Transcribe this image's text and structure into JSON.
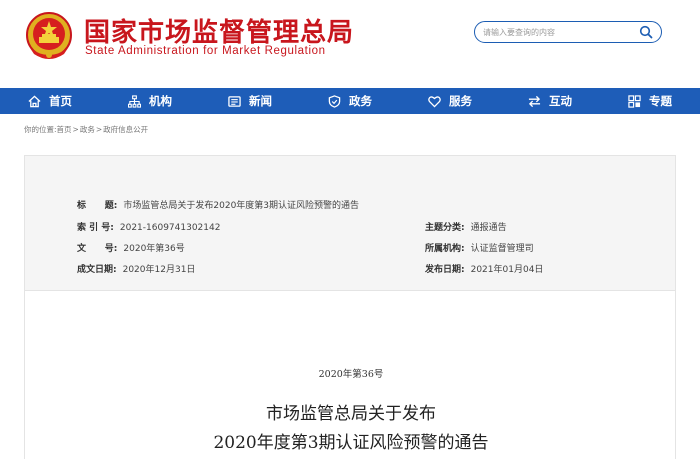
{
  "header": {
    "title_cn": "国家市场监督管理总局",
    "title_en": "State Administration for Market Regulation",
    "search_placeholder": "请输入要查询的内容"
  },
  "nav": {
    "items": [
      {
        "label": "首页",
        "icon": "home-icon"
      },
      {
        "label": "机构",
        "icon": "org-chart-icon"
      },
      {
        "label": "新闻",
        "icon": "news-icon"
      },
      {
        "label": "政务",
        "icon": "shield-icon"
      },
      {
        "label": "服务",
        "icon": "heart-icon"
      },
      {
        "label": "互动",
        "icon": "exchange-icon"
      },
      {
        "label": "专题",
        "icon": "grid-icon"
      }
    ]
  },
  "breadcrumb": {
    "prefix": "你的位置:",
    "items": [
      "首页",
      "政务",
      "政府信息公开"
    ],
    "separator": ">"
  },
  "info": {
    "title_label": "标      题:",
    "title_value": "市场监管总局关于发布2020年度第3期认证风险预警的通告",
    "index_label": "索 引 号:",
    "index_value": "2021-1609741302142",
    "category_label": "主题分类:",
    "category_value": "通报通告",
    "docno_label": "文      号:",
    "docno_value": "2020年第36号",
    "agency_label": "所属机构:",
    "agency_value": "认证监督管理司",
    "created_label": "成文日期:",
    "created_value": "2020年12月31日",
    "published_label": "发布日期:",
    "published_value": "2021年01月04日"
  },
  "document": {
    "number": "2020年第36号",
    "title_line1": "市场监管总局关于发布",
    "title_line2": "2020年度第3期认证风险预警的通告"
  },
  "colors": {
    "brand_red": "#c8161d",
    "nav_blue": "#1e5db8"
  }
}
